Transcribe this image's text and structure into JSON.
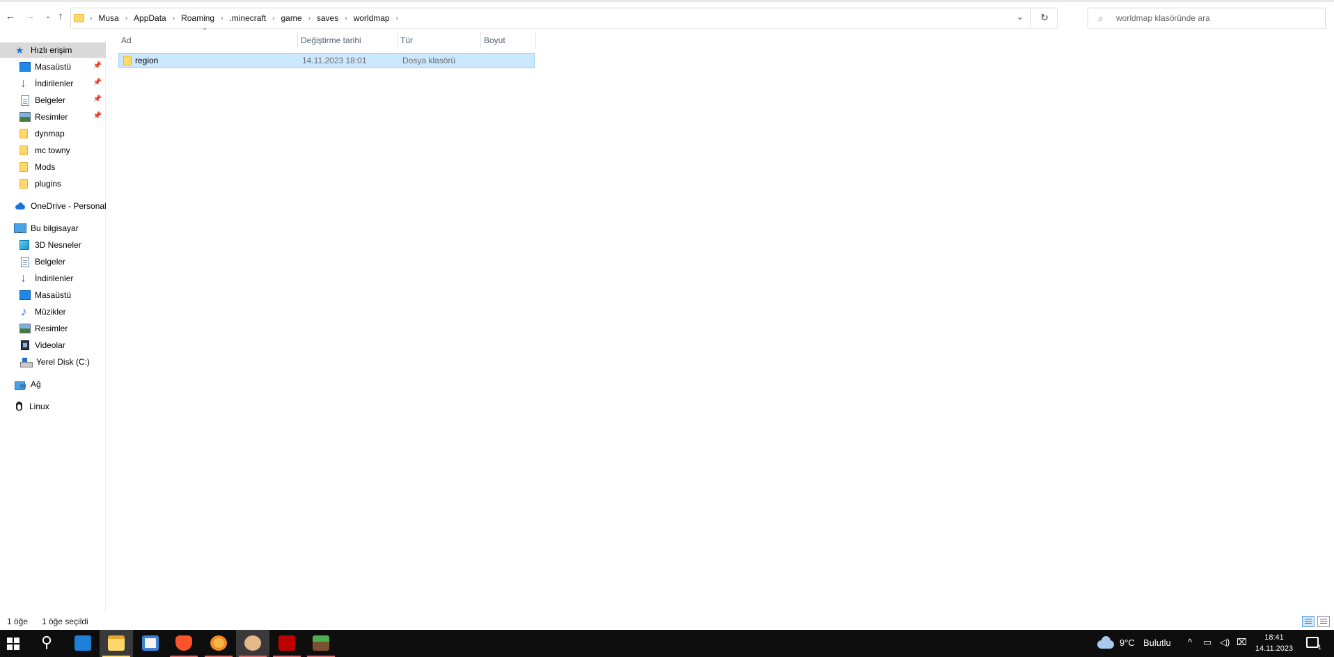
{
  "address": {
    "crumbs": [
      "Musa",
      "AppData",
      "Roaming",
      ".minecraft",
      "game",
      "saves",
      "worldmap"
    ],
    "search_placeholder": "worldmap klasöründe ara"
  },
  "sidebar": {
    "quick_access": "Hızlı erişim",
    "quick_items": [
      "Masaüstü",
      "İndirilenler",
      "Belgeler",
      "Resimler",
      "dynmap",
      "mc towny",
      "Mods",
      "plugins"
    ],
    "onedrive": "OneDrive - Personal",
    "this_pc": "Bu bilgisayar",
    "pc_items": [
      "3D Nesneler",
      "Belgeler",
      "İndirilenler",
      "Masaüstü",
      "Müzikler",
      "Resimler",
      "Videolar",
      "Yerel Disk (C:)"
    ],
    "network": "Ağ",
    "linux": "Linux"
  },
  "columns": {
    "name": "Ad",
    "modified": "Değiştirme tarihi",
    "type": "Tür",
    "size": "Boyut"
  },
  "files": [
    {
      "name": "region",
      "modified": "14.11.2023 18:01",
      "type": "Dosya klasörü",
      "size": ""
    }
  ],
  "status": {
    "count": "1 öğe",
    "selected": "1 öğe seçildi"
  },
  "taskbar": {
    "weather": "9°C",
    "weather_desc": "Bulutlu",
    "time": "18:41",
    "date": "14.11.2023",
    "notifications": "1"
  },
  "colors": {
    "accent": "#1a73d8",
    "selection": "#cce8ff",
    "folder": "#ffd76a",
    "taskbar": "#0e0e0e"
  }
}
